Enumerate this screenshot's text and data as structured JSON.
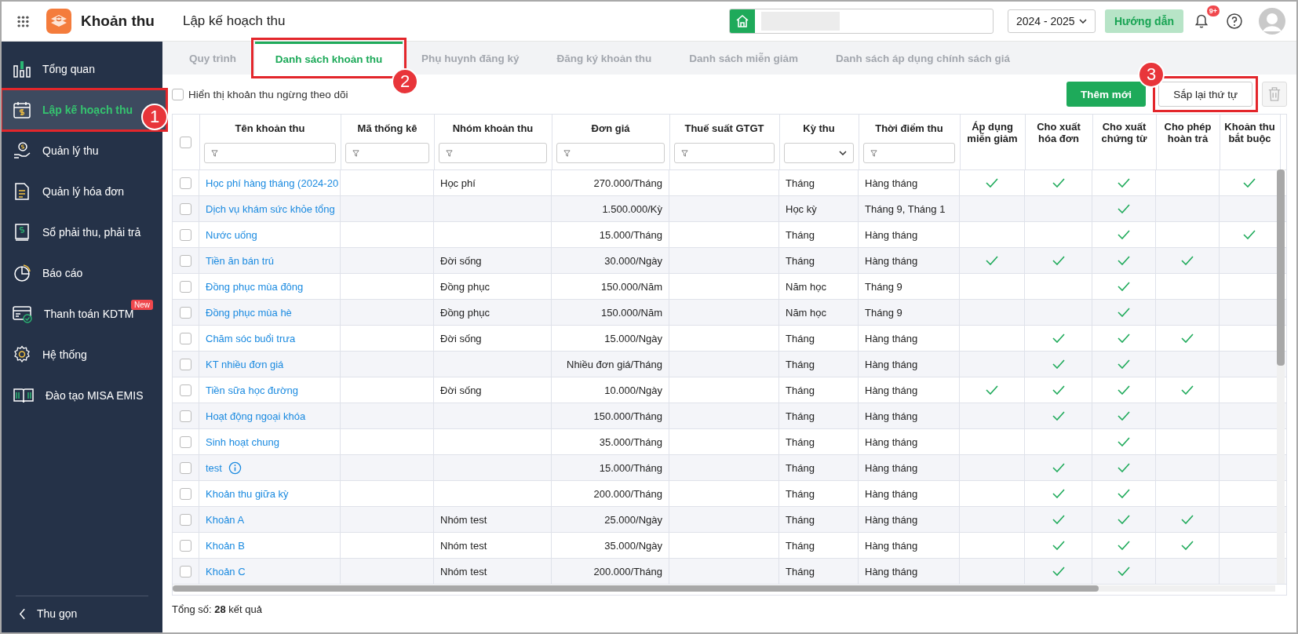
{
  "header": {
    "app_title": "Khoản thu",
    "page_title": "Lập kế hoạch thu",
    "year": "2024 - 2025",
    "guide_button": "Hướng dẫn",
    "notification_badge": "9+"
  },
  "sidebar": {
    "items": [
      {
        "label": "Tổng quan",
        "selected": false
      },
      {
        "label": "Lập kế hoạch thu",
        "selected": true,
        "callout": "1"
      },
      {
        "label": "Quản lý thu",
        "selected": false
      },
      {
        "label": "Quản lý hóa đơn",
        "selected": false
      },
      {
        "label": "Sổ phải thu, phải trả",
        "selected": false
      },
      {
        "label": "Báo cáo",
        "selected": false
      },
      {
        "label": "Thanh toán KDTM",
        "selected": false,
        "badge": "New"
      },
      {
        "label": "Hệ thống",
        "selected": false
      },
      {
        "label": "Đào tạo MISA EMIS",
        "selected": false
      }
    ],
    "collapse": "Thu gọn"
  },
  "tabs": [
    {
      "label": "Quy trình",
      "selected": false
    },
    {
      "label": "Danh sách khoản thu",
      "selected": true,
      "callout": "2"
    },
    {
      "label": "Phụ huynh đăng ký",
      "selected": false
    },
    {
      "label": "Đăng ký khoản thu",
      "selected": false
    },
    {
      "label": "Danh sách miễn giảm",
      "selected": false
    },
    {
      "label": "Danh sách áp dụng chính sách giá",
      "selected": false
    }
  ],
  "toolbar": {
    "show_inactive": {
      "label": "Hiển thị khoản thu ngừng theo dõi",
      "checked": false
    },
    "add_button": "Thêm mới",
    "reorder_button": {
      "label": "Sắp lại thứ tự",
      "callout": "3"
    },
    "delete_disabled": true
  },
  "table": {
    "select_all": {
      "checked": false
    },
    "columns": [
      {
        "label": "Tên khoản thu",
        "kind": "text"
      },
      {
        "label": "Mã thống kê",
        "kind": "text"
      },
      {
        "label": "Nhóm khoản thu",
        "kind": "text"
      },
      {
        "label": "Đơn giá",
        "kind": "text"
      },
      {
        "label": "Thuế suất GTGT",
        "kind": "text"
      },
      {
        "label": "Kỳ thu",
        "kind": "select"
      },
      {
        "label": "Thời điểm thu",
        "kind": "text"
      },
      {
        "label": "Áp dụng miễn giảm",
        "kind": "flag"
      },
      {
        "label": "Cho xuất hóa đơn",
        "kind": "flag"
      },
      {
        "label": "Cho xuất chứng từ",
        "kind": "flag"
      },
      {
        "label": "Cho phép hoàn trả",
        "kind": "flag"
      },
      {
        "label": "Khoản thu bắt buộc",
        "kind": "flag"
      }
    ],
    "rows": [
      {
        "selected": false,
        "name": "Học phí hàng tháng (2024-20",
        "group": "Học phí",
        "price": "270.000/Tháng",
        "period": "Tháng",
        "time": "Hàng tháng",
        "flags": [
          true,
          true,
          true,
          false,
          true
        ]
      },
      {
        "selected": false,
        "name": "Dịch vụ khám sức khỏe tổng",
        "price": "1.500.000/Kỳ",
        "period": "Học kỳ",
        "time": "Tháng 9, Tháng 1",
        "flags": [
          false,
          false,
          true,
          false,
          false
        ]
      },
      {
        "selected": false,
        "name": "Nước uống",
        "price": "15.000/Tháng",
        "period": "Tháng",
        "time": "Hàng tháng",
        "flags": [
          false,
          false,
          true,
          false,
          true
        ]
      },
      {
        "selected": false,
        "name": "Tiền ăn bán trú",
        "group": "Đời sống",
        "price": "30.000/Ngày",
        "period": "Tháng",
        "time": "Hàng tháng",
        "flags": [
          true,
          true,
          true,
          true,
          false
        ]
      },
      {
        "selected": false,
        "name": "Đồng phục mùa đông",
        "group": "Đồng phục",
        "price": "150.000/Năm",
        "period": "Năm học",
        "time": "Tháng 9",
        "flags": [
          false,
          false,
          true,
          false,
          false
        ]
      },
      {
        "selected": false,
        "name": "Đồng phục mùa hè",
        "group": "Đồng phục",
        "price": "150.000/Năm",
        "period": "Năm học",
        "time": "Tháng 9",
        "flags": [
          false,
          false,
          true,
          false,
          false
        ]
      },
      {
        "selected": false,
        "name": "Chăm sóc buổi trưa",
        "group": "Đời sống",
        "price": "15.000/Ngày",
        "period": "Tháng",
        "time": "Hàng tháng",
        "flags": [
          false,
          true,
          true,
          true,
          false
        ]
      },
      {
        "selected": false,
        "name": "KT nhiều đơn giá",
        "price": "Nhiều đơn giá/Tháng",
        "period": "Tháng",
        "time": "Hàng tháng",
        "flags": [
          false,
          true,
          true,
          false,
          false
        ]
      },
      {
        "selected": false,
        "name": "Tiền sữa học đường",
        "group": "Đời sống",
        "price": "10.000/Ngày",
        "period": "Tháng",
        "time": "Hàng tháng",
        "flags": [
          true,
          true,
          true,
          true,
          false
        ]
      },
      {
        "selected": false,
        "name": "Hoạt động ngoại khóa",
        "price": "150.000/Tháng",
        "period": "Tháng",
        "time": "Hàng tháng",
        "flags": [
          false,
          true,
          true,
          false,
          false
        ]
      },
      {
        "selected": false,
        "name": "Sinh hoạt chung",
        "price": "35.000/Tháng",
        "period": "Tháng",
        "time": "Hàng tháng",
        "flags": [
          false,
          false,
          true,
          false,
          false
        ]
      },
      {
        "selected": false,
        "name": "test",
        "info": true,
        "price": "15.000/Tháng",
        "period": "Tháng",
        "time": "Hàng tháng",
        "flags": [
          false,
          true,
          true,
          false,
          false
        ]
      },
      {
        "selected": false,
        "name": "Khoản thu giữa kỳ",
        "price": "200.000/Tháng",
        "period": "Tháng",
        "time": "Hàng tháng",
        "flags": [
          false,
          true,
          true,
          false,
          false
        ]
      },
      {
        "selected": false,
        "name": "Khoản A",
        "group": "Nhóm test",
        "price": "25.000/Ngày",
        "period": "Tháng",
        "time": "Hàng tháng",
        "flags": [
          false,
          true,
          true,
          true,
          false
        ]
      },
      {
        "selected": false,
        "name": "Khoản B",
        "group": "Nhóm test",
        "price": "35.000/Ngày",
        "period": "Tháng",
        "time": "Hàng tháng",
        "flags": [
          false,
          true,
          true,
          true,
          false
        ]
      },
      {
        "selected": false,
        "name": "Khoản C",
        "group": "Nhóm test",
        "price": "200.000/Tháng",
        "period": "Tháng",
        "time": "Hàng tháng",
        "flags": [
          false,
          true,
          true,
          false,
          false
        ]
      }
    ]
  },
  "total": "Tổng số: **28** kết quả"
}
